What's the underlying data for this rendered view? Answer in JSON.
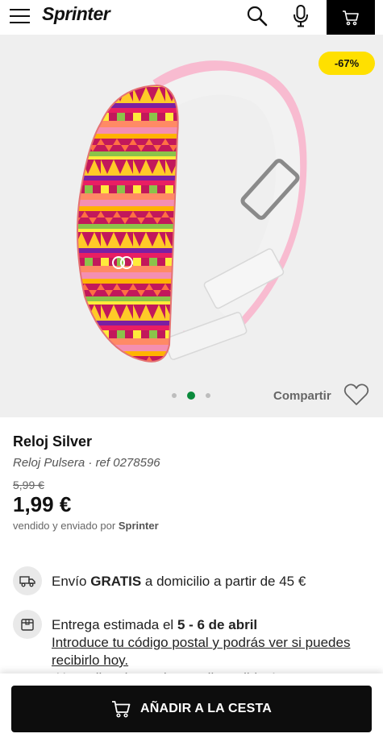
{
  "header": {
    "logo": "Sprinter",
    "icons": [
      "menu-icon",
      "search-icon",
      "microphone-icon",
      "cart-icon"
    ]
  },
  "gallery": {
    "discount_badge": "-67%",
    "share_label": "Compartir",
    "active_slide": 2,
    "total_slides": 3
  },
  "product": {
    "name": "Reloj Silver",
    "category": "Reloj Pulsera",
    "ref": "ref 0278596",
    "old_price": "5,99 €",
    "price": "1,99 €",
    "seller_prefix": "vendido y enviado por",
    "seller_name": "Sprinter"
  },
  "shipping": {
    "prefix": "Envío",
    "highlight": "GRATIS",
    "suffix": "a domicilio a partir de 45 €"
  },
  "delivery": {
    "prefix": "Entrega estimada el",
    "dates": "5 - 6 de abril",
    "link": "Introduce tu código postal y podrás ver si puedes recibirlo hoy.",
    "faded_text": "¡Hay miles de productos disponibles!"
  },
  "cta": {
    "add_to_cart": "AÑADIR A LA CESTA"
  },
  "colors": {
    "accent_green": "#0a8a3c",
    "badge_yellow": "#ffe000",
    "button_black": "#0d0d0d"
  }
}
